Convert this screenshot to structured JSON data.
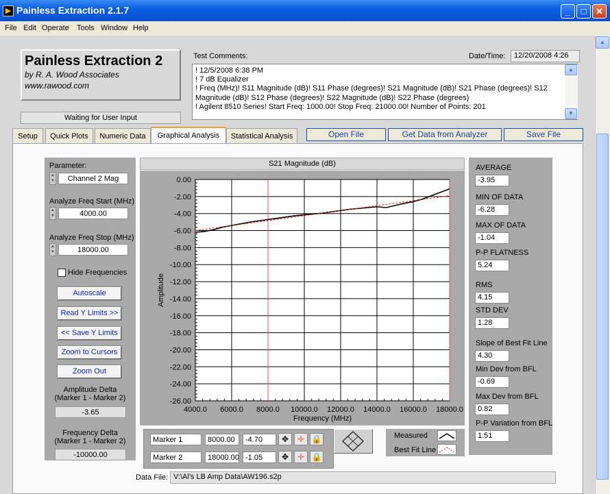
{
  "window": {
    "title": "Painless Extraction 2.1.7"
  },
  "menu": [
    "File",
    "Edit",
    "Operate",
    "Tools",
    "Window",
    "Help"
  ],
  "logo": {
    "title": "Painless Extraction 2",
    "by": "by R. A. Wood Associates",
    "url": "www.rawood.com"
  },
  "status": "Waiting for User Input",
  "comments": {
    "label": "Test Comments:",
    "lines": [
      "! 12/5/2008 6:38 PM",
      "! 7 dB Equalizer",
      "! Freq (MHz)! S11 Magnitude (dB)! S11 Phase (degrees)! S21 Magnitude (dB)! S21 Phase (degrees)! S12 Magnitude (dB)! S12 Phase (degrees)! S22 Magnitude (dB)! S22 Phase (degrees)",
      "! Agilent 8510 Series! Start Freq: 1000.00! Stop Freq: 21000.00! Number of Points: 201"
    ]
  },
  "datetime": {
    "label": "Date/Time:",
    "value": "12/20/2008  4:26"
  },
  "tabs": [
    "Setup",
    "Quick Plots",
    "Numeric Data",
    "Graphical Analysis",
    "Statistical Analysis"
  ],
  "buttons": {
    "open": "Open File",
    "get": "Get Data from Analyzer",
    "save": "Save File"
  },
  "left": {
    "parameter_label": "Parameter:",
    "parameter_value": "Channel 2 Mag",
    "start_label": "Analyze Freq Start (MHz)",
    "start_value": "4000.00",
    "stop_label": "Analyze Freq Stop (MHz)",
    "stop_value": "18000.00",
    "hide_freq": "Hide Frequencies",
    "autoscale": "Autoscale",
    "read_y": "Read Y Limits >>",
    "save_y": "<< Save Y Limits",
    "zoom_cursors": "Zoom to Cursors",
    "zoom_out": "Zoom Out",
    "amp_delta_label1": "Amplitude Delta",
    "amp_delta_label2": "(Marker 1 - Marker 2)",
    "amp_delta_value": "-3.65",
    "freq_delta_label1": "Frequency Delta",
    "freq_delta_label2": "(Marker 1 - Marker 2)",
    "freq_delta_value": "-10000.00"
  },
  "stats": [
    {
      "label": "AVERAGE",
      "value": "-3.95"
    },
    {
      "label": "MIN OF DATA",
      "value": "-6.28"
    },
    {
      "label": "MAX OF DATA",
      "value": "-1.04"
    },
    {
      "label": "P-P FLATNESS",
      "value": "5.24"
    },
    {
      "label": "RMS",
      "value": "4.15"
    },
    {
      "label": "STD DEV",
      "value": "1.28"
    },
    {
      "label": "Slope of Best Fit Line",
      "value": "4.30"
    },
    {
      "label": "Min Dev from BFL",
      "value": "-0.69"
    },
    {
      "label": "Max Dev from BFL",
      "value": "0.82"
    },
    {
      "label": "P-P Variation from BFL",
      "value": "1.51"
    }
  ],
  "markers": [
    {
      "name": "Marker 1",
      "freq": "8000.00",
      "amp": "-4.70"
    },
    {
      "name": "Marker 2",
      "freq": "18000.00",
      "amp": "-1.05"
    }
  ],
  "legend": {
    "measured": "Measured",
    "bestfit": "Best Fit Line"
  },
  "datafile": {
    "label": "Data File:",
    "value": "V:\\Al's LB Amp Data\\AW196.s2p"
  },
  "colors": {
    "measured": "#000000",
    "bestfit": "#e02020",
    "cursor": "#e05060"
  },
  "chart_data": {
    "type": "line",
    "title": "S21 Magnitude (dB)",
    "xlabel": "Frequency (MHz)",
    "ylabel": "Amplitude",
    "xlim": [
      4000,
      18000
    ],
    "ylim": [
      -26,
      0
    ],
    "xticks": [
      "4000.0",
      "6000.0",
      "8000.0",
      "10000.0",
      "12000.0",
      "14000.0",
      "16000.0",
      "18000.0"
    ],
    "yticks": [
      "0.00",
      "-2.00",
      "-4.00",
      "-6.00",
      "-8.00",
      "-10.00",
      "-12.00",
      "-14.00",
      "-16.00",
      "-18.00",
      "-20.00",
      "-22.00",
      "-24.00",
      "-26.00"
    ],
    "series": [
      {
        "name": "Measured",
        "x": [
          4000,
          4500,
          5000,
          5500,
          6000,
          6500,
          7000,
          7500,
          8000,
          8500,
          9000,
          9500,
          10000,
          10500,
          11000,
          11500,
          12000,
          12500,
          13000,
          13500,
          14000,
          14500,
          15000,
          15500,
          16000,
          16500,
          17000,
          17500,
          18000
        ],
        "y": [
          -6.2,
          -6.1,
          -5.9,
          -5.6,
          -5.4,
          -5.2,
          -5.0,
          -4.85,
          -4.7,
          -4.55,
          -4.4,
          -4.25,
          -4.15,
          -4.05,
          -3.95,
          -3.8,
          -3.65,
          -3.5,
          -3.4,
          -3.3,
          -3.2,
          -3.3,
          -3.05,
          -2.8,
          -2.6,
          -2.3,
          -1.9,
          -1.5,
          -1.1
        ]
      },
      {
        "name": "Best Fit Line",
        "x": [
          4000,
          18000
        ],
        "y": [
          -6.0,
          -1.9
        ]
      }
    ],
    "cursors_x": [
      8000,
      18000
    ]
  }
}
